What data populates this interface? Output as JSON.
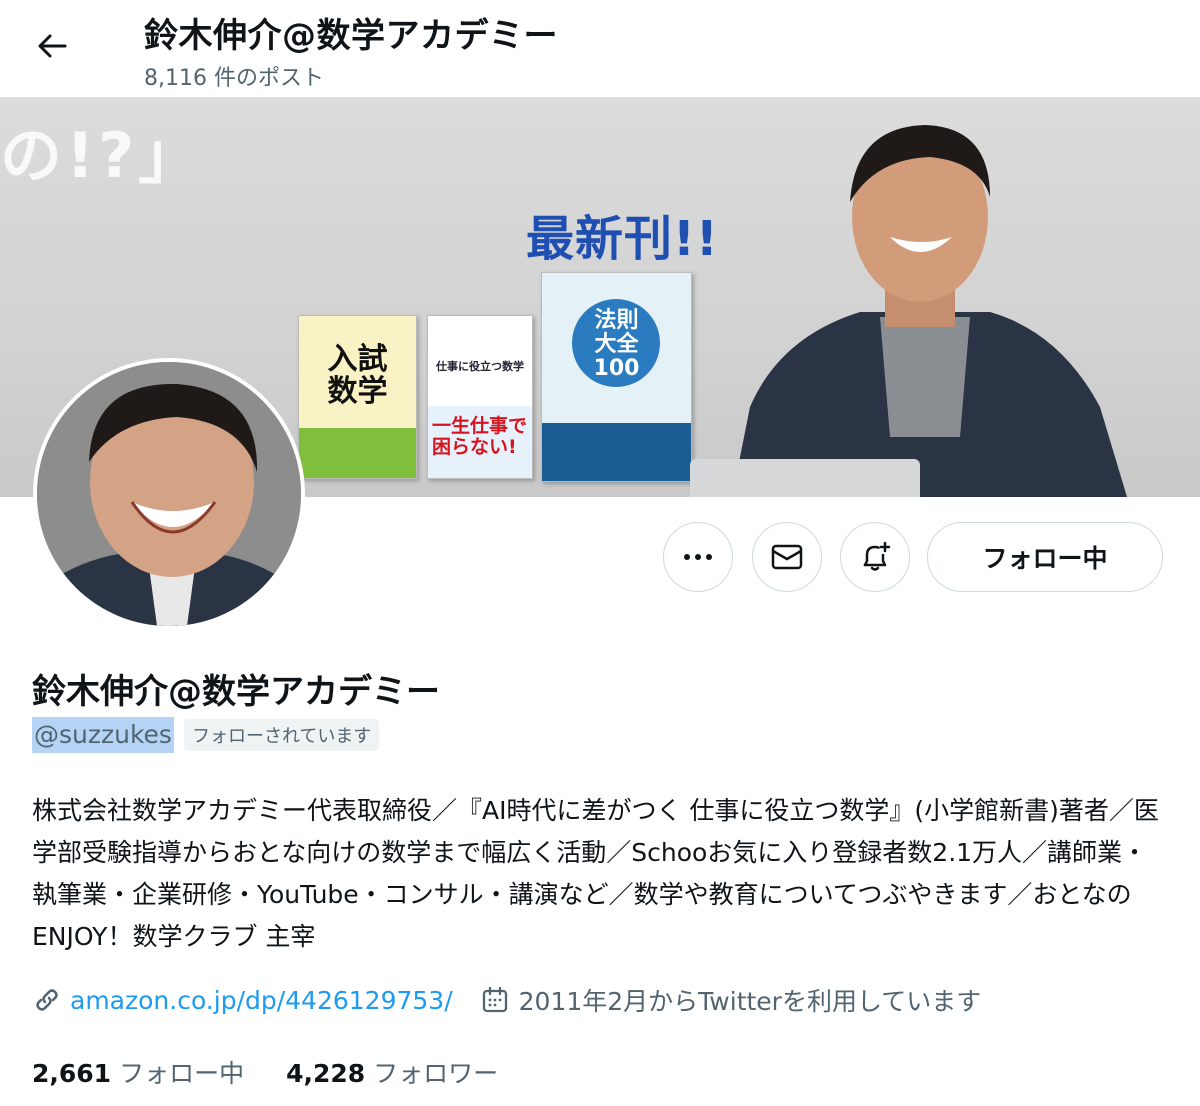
{
  "header": {
    "title": "鈴木伸介@数学アカデミー",
    "post_count": "8,116 件のポスト"
  },
  "banner": {
    "corner_text": "の!?」",
    "headline": "最新刊!!",
    "books": [
      {
        "title": "入試\n数学"
      },
      {
        "title": "仕事に役立つ数学",
        "highlight": "一生仕事で\n困らない!"
      },
      {
        "title": "法則\n大全\n100"
      }
    ]
  },
  "actions": {
    "more_icon": "more-dots-icon",
    "message_icon": "envelope-icon",
    "notify_icon": "bell-plus-icon",
    "follow_label": "フォロー中"
  },
  "profile": {
    "name": "鈴木伸介@数学アカデミー",
    "handle": "@suzzukes",
    "follows_you": "フォローされています",
    "bio": "株式会社数学アカデミー代表取締役／『AI時代に差がつく 仕事に役立つ数学』(小学館新書)著者／医学部受験指導からおとな向けの数学まで幅広く活動／Schooお気に入り登録者数2.1万人／講師業・執筆業・企業研修・YouTube・コンサル・講演など／数学や教育についてつぶやきます／おとなのENJOY！数学クラブ 主宰",
    "link": "amazon.co.jp/dp/4426129753/",
    "joined": "2011年2月からTwitterを利用しています"
  },
  "stats": {
    "following_count": "2,661",
    "following_label": "フォロー中",
    "followers_count": "4,228",
    "followers_label": "フォロワー"
  },
  "colors": {
    "accent": "#1d9bf0",
    "text": "#0f1419",
    "secondary": "#536471",
    "border": "#cfd9de"
  }
}
